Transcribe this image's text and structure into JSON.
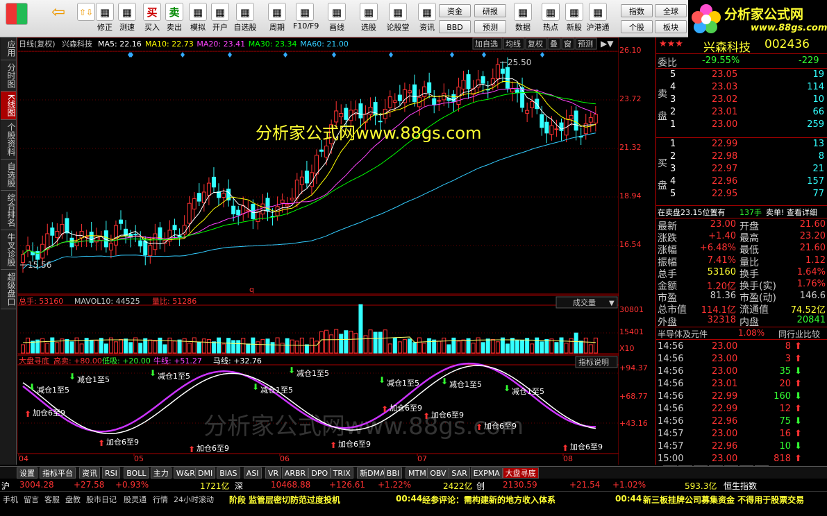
{
  "toolbar": {
    "items": [
      {
        "label": "",
        "icon": "grid-icon"
      },
      {
        "label": "",
        "icon": "back-arrow-icon"
      },
      {
        "label": "",
        "icon": "up-down-arrows-icon"
      },
      {
        "label": "修正",
        "icon": "revise-icon"
      },
      {
        "label": "测速",
        "icon": "clock-icon"
      },
      {
        "label": "买入",
        "icon": "buy-icon",
        "glyph": "买"
      },
      {
        "label": "卖出",
        "icon": "sell-icon",
        "glyph": "卖"
      },
      {
        "label": "模拟",
        "icon": "hammer-icon"
      },
      {
        "label": "开户",
        "icon": "lock-icon"
      },
      {
        "label": "自选股",
        "icon": "star-icon"
      },
      {
        "label": "周期",
        "icon": "period-icon"
      },
      {
        "label": "F10/F9",
        "icon": "f10-icon"
      },
      {
        "label": "画线",
        "icon": "pencil-icon"
      },
      {
        "label": "选股",
        "icon": "select-stock-icon"
      },
      {
        "label": "论股堂",
        "icon": "forum-icon"
      },
      {
        "label": "资讯",
        "icon": "news-icon"
      },
      {
        "label": "数据",
        "icon": "pe-icon"
      },
      {
        "label": "热点",
        "icon": "hot-icon"
      },
      {
        "label": "新股",
        "icon": "new-stock-icon"
      },
      {
        "label": "沪港通",
        "icon": "hk-icon"
      }
    ],
    "small_buttons": [
      "资金",
      "BBD",
      "研报",
      "预测",
      "指数",
      "个股",
      "全球",
      "板块"
    ]
  },
  "logo": {
    "title": "分析家公式网",
    "url": "www.88gs.com"
  },
  "left_tabs": [
    "应用",
    "分时图",
    "K线图",
    "个股资料",
    "自选股",
    "综合排名",
    "牛叉诊股",
    "超级盘口"
  ],
  "kline": {
    "period": "日线(复权)",
    "name": "兴森科技",
    "ma": [
      {
        "label": "MA5: 22.16",
        "color": "#ffffff"
      },
      {
        "label": "MA10: 22.73",
        "color": "#ffff00"
      },
      {
        "label": "MA20: 23.41",
        "color": "#ff44ff"
      },
      {
        "label": "MA30: 23.34",
        "color": "#00ff00"
      },
      {
        "label": "MA60: 21.00",
        "color": "#33ccff"
      }
    ],
    "buttons": [
      "加自选",
      "均线",
      "复权",
      "叠",
      "窗",
      "预测"
    ],
    "watermark": "分析家公式网www.88gs.com",
    "high_label": "25.50",
    "low_label": "15.56",
    "axis": [
      "26.10",
      "23.72",
      "21.32",
      "18.94",
      "16.54"
    ]
  },
  "volume": {
    "total": "总手: 53160",
    "mavol": "MAVOL10: 44525",
    "ratio": "量比: 51286",
    "dropdown": "成交量",
    "axis": [
      "30801",
      "15401",
      "X10"
    ]
  },
  "indicator": {
    "name": "大盘寻底",
    "high": "高卖: +80.00",
    "low": "低吸: +20.00",
    "bull": "牛线: +51.27",
    "horse": "马线: +32.76",
    "button": "指标说明",
    "axis": [
      "+94.37",
      "+68.77",
      "+43.16"
    ],
    "sell_text": "减仓1至5",
    "buy_text": "加仓6至9",
    "watermark": "分析家公式网www.88gs.com"
  },
  "dates": [
    "04",
    "05",
    "06",
    "07",
    "08"
  ],
  "quote": {
    "name": "兴森科技",
    "code": "002436",
    "ratio_label": "委比",
    "ratio": "-29.55%",
    "ratio2": "-229",
    "sell": [
      {
        "n": "5",
        "p": "23.05",
        "v": "19"
      },
      {
        "n": "4",
        "p": "23.03",
        "v": "114"
      },
      {
        "n": "3",
        "p": "23.02",
        "v": "10"
      },
      {
        "n": "2",
        "p": "23.01",
        "v": "66"
      },
      {
        "n": "1",
        "p": "23.00",
        "v": "259"
      }
    ],
    "buy": [
      {
        "n": "1",
        "p": "22.99",
        "v": "13"
      },
      {
        "n": "2",
        "p": "22.98",
        "v": "8"
      },
      {
        "n": "3",
        "p": "22.97",
        "v": "21"
      },
      {
        "n": "4",
        "p": "22.96",
        "v": "157"
      },
      {
        "n": "5",
        "p": "22.95",
        "v": "77"
      }
    ],
    "sell_label": "卖盘",
    "buy_label": "买盘",
    "pending": "在卖盘23.15位置有",
    "pending_vol": "137手",
    "pending_act": "卖单! 查看详细",
    "stats": [
      [
        "最新",
        "23.00",
        "开盘",
        "21.60"
      ],
      [
        "涨跌",
        "+1.40",
        "最高",
        "23.20"
      ],
      [
        "涨幅",
        "+6.48%",
        "最低",
        "21.60"
      ],
      [
        "振幅",
        "7.41%",
        "量比",
        "1.12"
      ],
      [
        "总手",
        "53160",
        "换手",
        "1.64%"
      ],
      [
        "金额",
        "1.20亿",
        "换手(实)",
        "1.76%"
      ],
      [
        "市盈",
        "81.36",
        "市盈(动)",
        "146.6"
      ],
      [
        "总市值",
        "114.1亿",
        "流通值",
        "74.52亿"
      ],
      [
        "外盘",
        "32318",
        "内盘",
        "20841"
      ]
    ],
    "sector": "半导体及元件",
    "sector_pct": "1.08%",
    "compare": "同行业比较",
    "ticks": [
      [
        "14:56",
        "23.00",
        "8",
        "up"
      ],
      [
        "14:56",
        "23.00",
        "3",
        "up"
      ],
      [
        "14:56",
        "23.00",
        "35",
        "down"
      ],
      [
        "14:56",
        "23.01",
        "20",
        "up"
      ],
      [
        "14:56",
        "22.99",
        "160",
        "down"
      ],
      [
        "14:56",
        "22.99",
        "12",
        "up"
      ],
      [
        "14:56",
        "22.96",
        "75",
        "down"
      ],
      [
        "14:57",
        "23.00",
        "16",
        "up"
      ],
      [
        "14:57",
        "22.96",
        "10",
        "down"
      ],
      [
        "15:00",
        "23.00",
        "818",
        "up"
      ]
    ],
    "tabs": [
      "细",
      "诊",
      "分",
      "筹",
      "焰",
      "操",
      "财"
    ]
  },
  "bottom_tabs": [
    "设置",
    "指标平台",
    "资讯",
    "RSI",
    "BOLL",
    "主力",
    "W&R",
    "DMI",
    "BIAS",
    "ASI",
    "VR",
    "ARBR",
    "DPO",
    "TRIX",
    "新DMA",
    "BBI",
    "MTM",
    "OBV",
    "SAR",
    "EXPMA",
    "大盘寻底"
  ],
  "index_bar": {
    "sh": "沪",
    "sh_val": "3004.28",
    "sh_chg": "+27.58",
    "sh_pct": "+0.93%",
    "sh_amt": "1721亿",
    "sz": "深",
    "sz_val": "10468.88",
    "sz_chg": "+126.61",
    "sz_pct": "+1.22%",
    "sz_amt": "2422亿",
    "cy": "创",
    "cy_val": "2130.59",
    "cy_chg": "+21.54",
    "cy_pct": "+1.02%",
    "hs_amt": "593.3亿",
    "hs": "恒生指数"
  },
  "news": {
    "left": "监管层密切防范过度投机",
    "prefix": "阶段",
    "t1": "00:44",
    "n1": "经参评论：需构建新的地方收入体系",
    "t2": "00:44",
    "n2": "新三板挂牌公司募集资金 不得用于股票交易"
  },
  "status": [
    "手机",
    "留言",
    "客服",
    "盘教",
    "股市日记",
    "股灵通",
    "行情",
    "24小时滚动"
  ]
}
